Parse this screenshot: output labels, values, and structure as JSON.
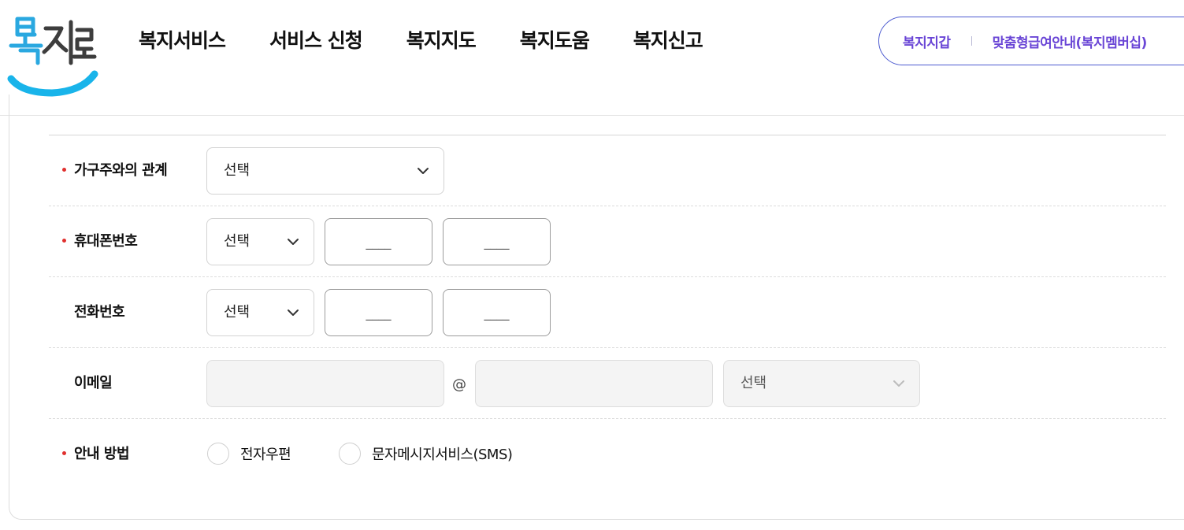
{
  "header": {
    "logo_icon": "bokjiro-logo",
    "nav": [
      {
        "label": "복지서비스"
      },
      {
        "label": "서비스 신청"
      },
      {
        "label": "복지지도"
      },
      {
        "label": "복지도움"
      },
      {
        "label": "복지신고"
      }
    ],
    "util_links": [
      {
        "label": "복지지갑"
      },
      {
        "label": "맞춤형급여안내(복지멤버십)"
      }
    ],
    "accent_color": "#6a46d6"
  },
  "form": {
    "relationship": {
      "label": "가구주와의 관계",
      "required": true,
      "select_value": "선택"
    },
    "mobile": {
      "label": "휴대폰번호",
      "required": true,
      "prefix_value": "선택",
      "part2_placeholder": "____",
      "part3_placeholder": "____"
    },
    "phone": {
      "label": "전화번호",
      "required": false,
      "prefix_value": "선택",
      "part2_placeholder": "____",
      "part3_placeholder": "____"
    },
    "email": {
      "label": "이메일",
      "required": false,
      "local_value": "",
      "at_symbol": "@",
      "domain_value": "",
      "domain_select_value": "선택"
    },
    "notice_method": {
      "label": "안내 방법",
      "required": true,
      "options": [
        {
          "label": "전자우편",
          "checked": false
        },
        {
          "label": "문자메시지서비스(SMS)",
          "checked": false
        }
      ]
    },
    "required_mark_color": "#e0302e"
  }
}
